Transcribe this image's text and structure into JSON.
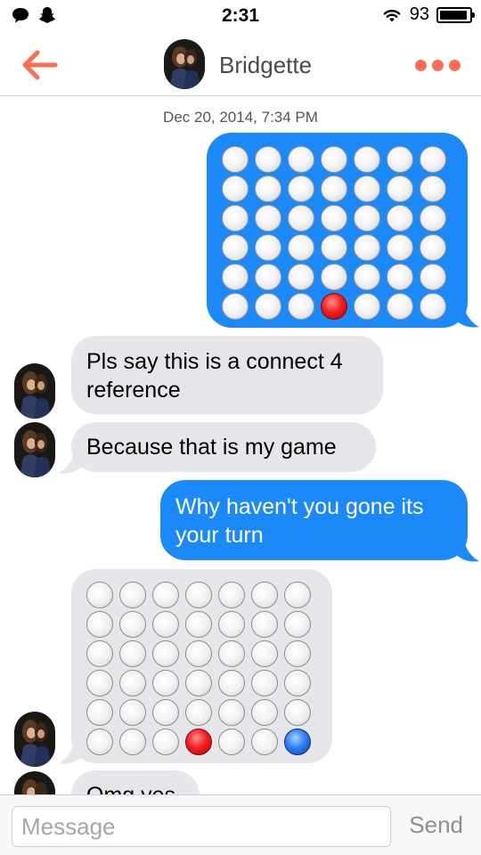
{
  "status_bar": {
    "time": "2:31",
    "battery_percent": "93",
    "battery_level": 0.93,
    "icons": [
      "chat-bubble-icon",
      "snapchat-ghost-icon",
      "wifi-icon",
      "battery-icon"
    ]
  },
  "header": {
    "contact_name": "Bridgette",
    "back_icon": "arrow-left-icon",
    "more_icon": "more-dots-icon",
    "accent_color": "#fe6d4f"
  },
  "conversation": {
    "timestamp": "Dec 20, 2014, 7:34 PM",
    "messages": [
      {
        "sender": "me",
        "type": "board",
        "pieces": [
          {
            "row": 6,
            "col": 4,
            "color": "red"
          }
        ]
      },
      {
        "sender": "them",
        "type": "text",
        "lines": [
          "Pls say this is a connect 4",
          "reference"
        ]
      },
      {
        "sender": "them",
        "type": "text",
        "lines": [
          "Because that is my game"
        ]
      },
      {
        "sender": "me",
        "type": "text",
        "lines": [
          "Why haven't you gone its",
          "your turn"
        ]
      },
      {
        "sender": "them",
        "type": "board",
        "pieces": [
          {
            "row": 6,
            "col": 4,
            "color": "red"
          },
          {
            "row": 6,
            "col": 7,
            "color": "blue"
          }
        ]
      },
      {
        "sender": "them",
        "type": "text",
        "lines": [
          "Omg yes"
        ]
      }
    ]
  },
  "composer": {
    "placeholder": "Message",
    "send_label": "Send"
  },
  "colors": {
    "sent_bubble": "#1b89f8",
    "received_bubble": "#e5e5ea",
    "red_piece": "#f41f1f",
    "blue_piece": "#2f7ff2"
  }
}
